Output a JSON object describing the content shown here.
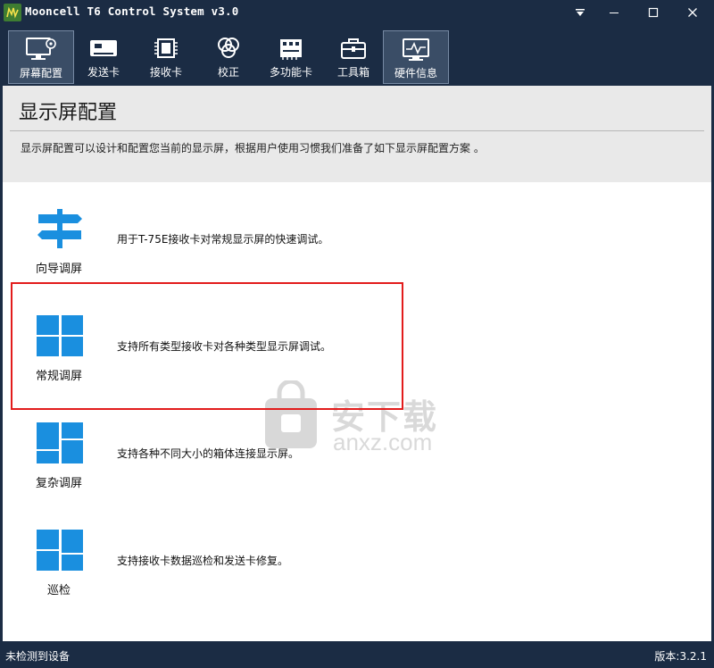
{
  "window": {
    "title": "Mooncell T6 Control System v3.0",
    "icons": [
      "app-logo-icon",
      "dropdown-icon",
      "minimize-icon",
      "maximize-icon",
      "close-icon"
    ]
  },
  "toolbar": {
    "items": [
      {
        "label": "屏幕配置",
        "icon": "monitor-settings-icon",
        "active": true
      },
      {
        "label": "发送卡",
        "icon": "sender-card-icon",
        "active": false
      },
      {
        "label": "接收卡",
        "icon": "chip-icon",
        "active": false
      },
      {
        "label": "校正",
        "icon": "color-wheel-icon",
        "active": false
      },
      {
        "label": "多功能卡",
        "icon": "multifunction-card-icon",
        "active": false
      },
      {
        "label": "工具箱",
        "icon": "toolbox-icon",
        "active": false
      },
      {
        "label": "硬件信息",
        "icon": "hardware-monitor-icon",
        "active": false
      }
    ]
  },
  "page": {
    "title": "显示屏配置",
    "description": "显示屏配置可以设计和配置您当前的显示屏，根据用户使用习惯我们准备了如下显示屏配置方案 。"
  },
  "options": [
    {
      "label": "向导调屏",
      "description": "用于T-75E接收卡对常规显示屏的快速调试。",
      "icon": "signpost-icon"
    },
    {
      "label": "常规调屏",
      "description": "支持所有类型接收卡对各种类型显示屏调试。",
      "icon": "grid-four-icon"
    },
    {
      "label": "复杂调屏",
      "description": "支持各种不同大小的箱体连接显示屏。",
      "icon": "grid-complex-icon"
    },
    {
      "label": "巡检",
      "description": "支持接收卡数据巡检和发送卡修复。",
      "icon": "grid-inspect-icon"
    }
  ],
  "watermark": {
    "cn": "安下载",
    "en": "anxz.com"
  },
  "status": {
    "left": "未检测到设备",
    "right": "版本:3.2.1"
  },
  "colors": {
    "chrome": "#1b2c44",
    "accent_blue": "#1a8fdf",
    "highlight_red": "#e21c1c",
    "header_gray": "#e9e9e9"
  }
}
